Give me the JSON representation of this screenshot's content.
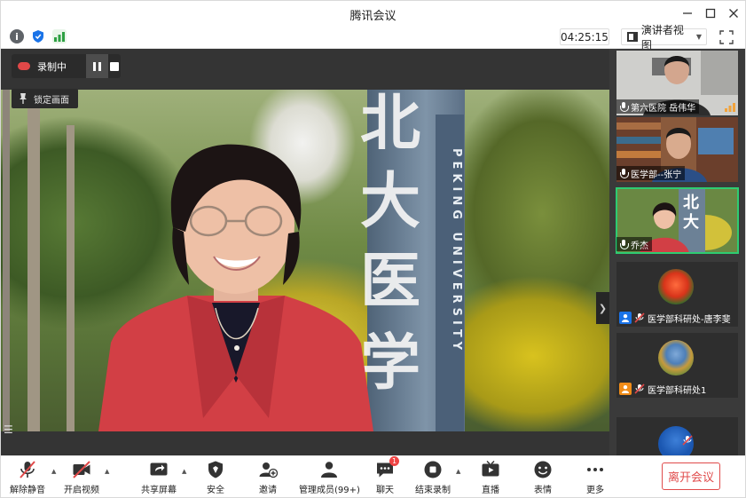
{
  "window": {
    "title": "腾讯会议"
  },
  "topbar": {
    "timer": "04:25:15",
    "view_mode": "演讲者视图"
  },
  "stage": {
    "recording_label": "录制中",
    "lock_label": "锁定画面",
    "pillar_chars": [
      "北",
      "大",
      "医",
      "学"
    ],
    "pillar_english": "PEKING UNIVERSITY"
  },
  "participants": [
    {
      "name": "第六医院  岳伟华",
      "type": "video",
      "speaking": true
    },
    {
      "name": "医学部--张宁",
      "type": "video",
      "speaking": false
    },
    {
      "name": "乔杰",
      "type": "video",
      "speaking": false,
      "active": true
    },
    {
      "name": "医学部科研处-唐李斐",
      "type": "avatar",
      "muted": true
    },
    {
      "name": "医学部科研处1",
      "type": "avatar",
      "muted": true
    },
    {
      "name": "",
      "type": "avatar",
      "muted": true
    }
  ],
  "controls": {
    "unmute": "解除静音",
    "start_video": "开启视频",
    "share_screen": "共享屏幕",
    "security": "安全",
    "invite": "邀请",
    "manage_members": "管理成员(99+)",
    "chat": "聊天",
    "chat_badge": "1",
    "end_recording": "结束录制",
    "live": "直播",
    "reactions": "表情",
    "more": "更多",
    "leave": "离开会议"
  },
  "colors": {
    "accent_green": "#2ecc71",
    "leave_red": "#e04b4b",
    "brand_blue": "#1a73e8"
  }
}
